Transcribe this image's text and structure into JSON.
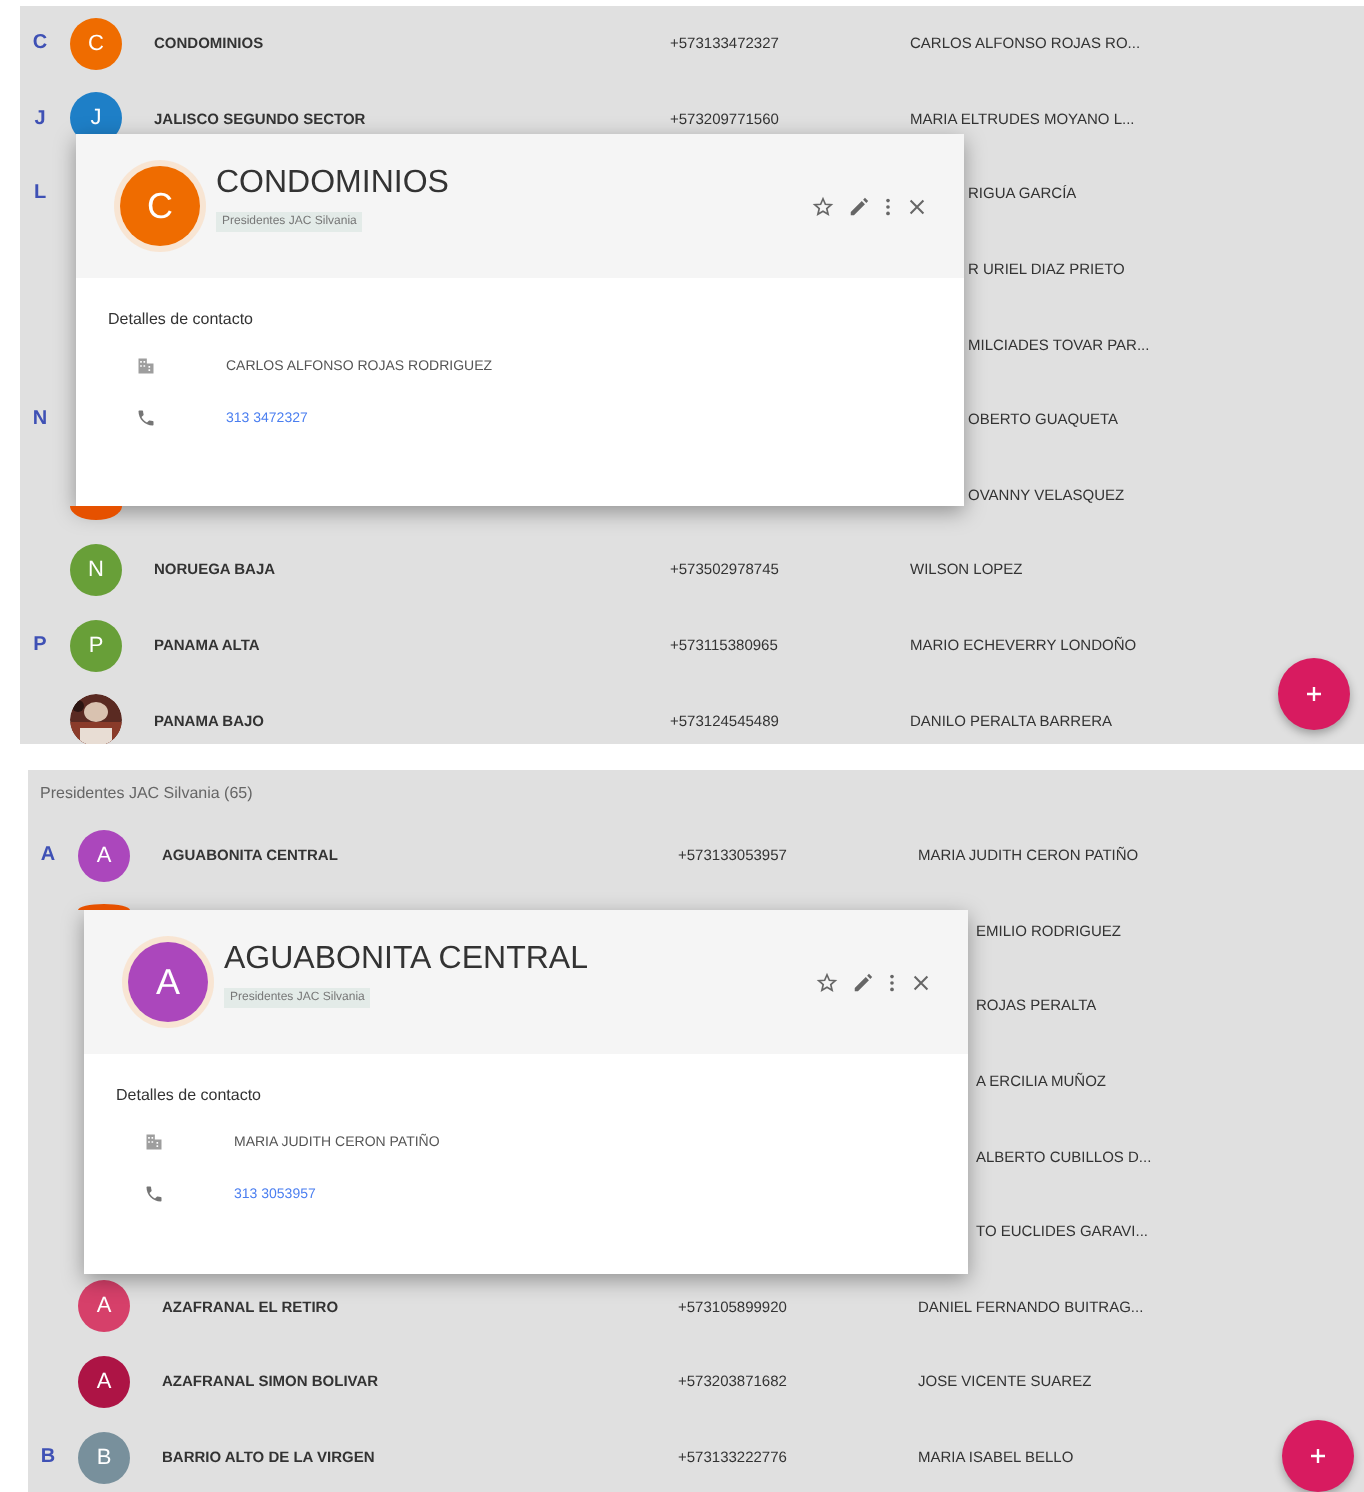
{
  "panels": [
    {
      "rows": [
        {
          "kind": "full",
          "letter": "C",
          "avatar": {
            "kind": "letter",
            "text": "C",
            "color": "#ef6c00"
          },
          "name": "CONDOMINIOS",
          "phone": "+573133472327",
          "contact": "CARLOS ALFONSO ROJAS RO..."
        },
        {
          "kind": "full",
          "letter": "J",
          "avatar": {
            "kind": "letter",
            "text": "J",
            "color": "#1e7fc7"
          },
          "name": "JALISCO SEGUNDO SECTOR",
          "phone": "+573209771560",
          "contact": "MARIA ELTRUDES MOYANO L..."
        },
        {
          "kind": "covered",
          "letter": "L",
          "contact": "RIGUA GARCÍA"
        },
        {
          "kind": "covered",
          "contact": "R URIEL DIAZ PRIETO"
        },
        {
          "kind": "covered",
          "contact": "MILCIADES TOVAR PAR..."
        },
        {
          "kind": "covered",
          "letter": "N",
          "contact": "OBERTO GUAQUETA"
        },
        {
          "kind": "covered",
          "avatar": {
            "kind": "bottomedge",
            "color": "#e65100"
          },
          "contact": "OVANNY VELASQUEZ"
        },
        {
          "kind": "full",
          "avatar": {
            "kind": "letter",
            "text": "N",
            "color": "#689f38"
          },
          "name": "NORUEGA BAJA",
          "phone": "+573502978745",
          "contact": "WILSON LOPEZ"
        },
        {
          "kind": "full",
          "letter": "P",
          "avatar": {
            "kind": "letter",
            "text": "P",
            "color": "#689f38"
          },
          "name": "PANAMA ALTA",
          "phone": "+573115380965",
          "contact": "MARIO ECHEVERRY LONDOÑO"
        },
        {
          "kind": "full",
          "name": "PANAMA BAJO",
          "phone": "+573124545489",
          "contact": "DANILO PERALTA BARRERA"
        }
      ],
      "card": {
        "avatar": {
          "letter": "C",
          "color": "#ef6c00"
        },
        "title": "CONDOMINIOS",
        "chip": "Presidentes JAC Silvania",
        "section": "Detalles de contacto",
        "person": "CARLOS ALFONSO ROJAS RODRIGUEZ",
        "phone": "313 3472327"
      }
    },
    {
      "header": "Presidentes JAC Silvania (65)",
      "rows": [
        {
          "kind": "full",
          "letter": "A",
          "avatar": {
            "kind": "letter",
            "text": "A",
            "color": "#ab47bc"
          },
          "name": "AGUABONITA CENTRAL",
          "phone": "+573133053957",
          "contact": "MARIA JUDITH CERON PATIÑO"
        },
        {
          "kind": "covered",
          "avatar": {
            "kind": "topedge",
            "color": "#e65100"
          },
          "contact": "EMILIO RODRIGUEZ"
        },
        {
          "kind": "covered",
          "contact": "ROJAS PERALTA"
        },
        {
          "kind": "covered",
          "contact": "A ERCILIA MUÑOZ"
        },
        {
          "kind": "covered",
          "contact": "ALBERTO CUBILLOS D..."
        },
        {
          "kind": "covered",
          "contact": "TO EUCLIDES GARAVI..."
        },
        {
          "kind": "full",
          "avatar": {
            "kind": "letter",
            "text": "A",
            "color": "#d6406a"
          },
          "name": "AZAFRANAL EL RETIRO",
          "phone": "+573105899920",
          "contact": "DANIEL FERNANDO BUITRAG..."
        },
        {
          "kind": "full",
          "avatar": {
            "kind": "letter",
            "text": "A",
            "color": "#ad1445"
          },
          "name": "AZAFRANAL SIMON BOLIVAR",
          "phone": "+573203871682",
          "contact": "JOSE VICENTE SUAREZ"
        },
        {
          "kind": "full",
          "letter": "B",
          "avatar": {
            "kind": "letter",
            "text": "B",
            "color": "#78909c"
          },
          "name": "BARRIO ALTO DE LA VIRGEN",
          "phone": "+573133222776",
          "contact": "MARIA ISABEL BELLO"
        }
      ],
      "card": {
        "avatar": {
          "letter": "A",
          "color": "#ab47bc"
        },
        "title": "AGUABONITA CENTRAL",
        "chip": "Presidentes JAC Silvania",
        "section": "Detalles de contacto",
        "person": "MARIA JUDITH CERON PATIÑO",
        "phone": "313 3053957"
      }
    }
  ]
}
